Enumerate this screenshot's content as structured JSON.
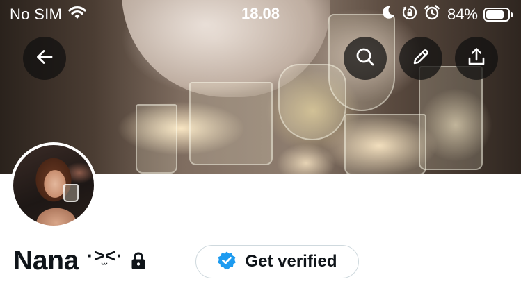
{
  "status_bar": {
    "carrier": "No SIM",
    "time": "18.08",
    "battery_percent_text": "84%",
    "battery_level": 0.84,
    "icons": [
      "wifi-icon",
      "moon-icon",
      "orientation-lock-icon",
      "alarm-icon",
      "battery-icon"
    ]
  },
  "header": {
    "buttons": {
      "back": "arrow-left-icon",
      "search": "search-icon",
      "edit": "pencil-icon",
      "share": "share-icon"
    }
  },
  "profile": {
    "name": "Nana",
    "name_decoration": "·>̫<·",
    "protected_icon": "lock-icon",
    "verify_button": {
      "label": "Get verified",
      "icon": "verified-badge-icon",
      "accent": "#1d9bf0"
    }
  },
  "colors": {
    "text_primary": "#0f1419",
    "button_border": "#cfd9de",
    "overlay_button_bg": "rgba(15,15,15,0.72)"
  }
}
